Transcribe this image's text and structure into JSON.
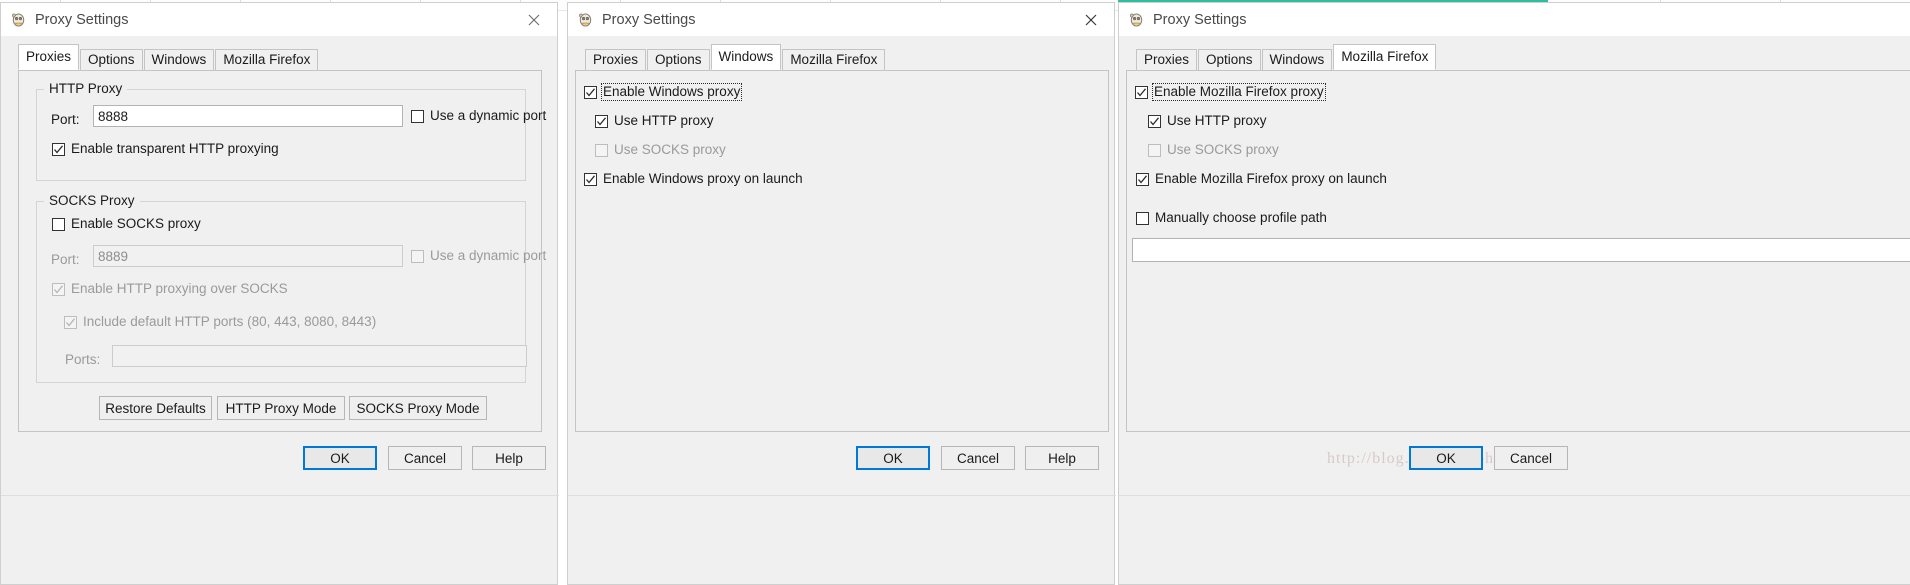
{
  "common": {
    "window_title": "Proxy Settings",
    "close_label": "Close",
    "tabs": [
      "Proxies",
      "Options",
      "Windows",
      "Mozilla Firefox"
    ],
    "ok_label": "OK",
    "cancel_label": "Cancel",
    "help_label": "Help"
  },
  "dialog1": {
    "title": "Proxy Settings",
    "active_tab": "Proxies",
    "tabs": [
      "Proxies",
      "Options",
      "Windows",
      "Mozilla Firefox"
    ],
    "http_group": {
      "title": "HTTP Proxy",
      "port_label": "Port:",
      "port_value": "8888",
      "dynamic_port_label": "Use a dynamic port",
      "dynamic_port_checked": false,
      "transparent_label": "Enable transparent HTTP proxying",
      "transparent_checked": true
    },
    "socks_group": {
      "title": "SOCKS Proxy",
      "enable_label": "Enable SOCKS proxy",
      "enable_checked": false,
      "port_label": "Port:",
      "port_value": "8889",
      "dynamic_port_label": "Use a dynamic port",
      "dynamic_port_checked": false,
      "http_over_socks_label": "Enable HTTP proxying over SOCKS",
      "http_over_socks_checked": true,
      "include_default_label": "Include default HTTP ports (80, 443, 8080, 8443)",
      "include_default_checked": true,
      "ports_label": "Ports:",
      "ports_value": ""
    },
    "action_buttons": [
      "Restore Defaults",
      "HTTP Proxy Mode",
      "SOCKS Proxy Mode"
    ],
    "ok_label": "OK",
    "cancel_label": "Cancel",
    "help_label": "Help"
  },
  "dialog2": {
    "title": "Proxy Settings",
    "active_tab": "Windows",
    "tabs": [
      "Proxies",
      "Options",
      "Windows",
      "Mozilla Firefox"
    ],
    "enable_label": "Enable Windows proxy",
    "enable_checked": true,
    "use_http_label": "Use HTTP proxy",
    "use_http_checked": true,
    "use_socks_label": "Use SOCKS proxy",
    "use_socks_checked": false,
    "on_launch_label": "Enable Windows proxy on launch",
    "on_launch_checked": true,
    "ok_label": "OK",
    "cancel_label": "Cancel",
    "help_label": "Help"
  },
  "dialog3": {
    "title": "Proxy Settings",
    "active_tab": "Mozilla Firefox",
    "tabs": [
      "Proxies",
      "Options",
      "Windows",
      "Mozilla Firefox"
    ],
    "enable_label": "Enable Mozilla Firefox proxy",
    "enable_checked": true,
    "use_http_label": "Use HTTP proxy",
    "use_http_checked": true,
    "use_socks_label": "Use SOCKS proxy",
    "use_socks_checked": false,
    "on_launch_label": "Enable Mozilla Firefox proxy on launch",
    "on_launch_checked": true,
    "manual_profile_label": "Manually choose profile path",
    "manual_profile_checked": false,
    "profile_path_value": "",
    "ok_label": "OK",
    "cancel_label": "Cancel",
    "watermark": "http://blog.csdn.net/phyoooo"
  },
  "colors": {
    "accent_focus": "#0078d7",
    "dialog_bg": "#f0f0f0",
    "titlebar_bg": "#ffffff",
    "disabled_text": "#9a9a9a",
    "green_edge": "#2fbfa0"
  }
}
